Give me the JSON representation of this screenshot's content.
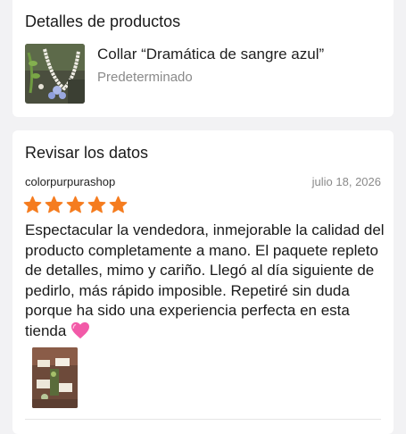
{
  "products_section": {
    "title": "Detalles de productos",
    "item": {
      "name": "Collar “Dramática de sangre azul”",
      "variant": "Predeterminado"
    }
  },
  "review_section": {
    "title": "Revisar los datos",
    "shop_name": "colorpurpurashop",
    "date": "julio 18, 2026",
    "rating": 5,
    "rating_max": 5,
    "text": "Espectacular la vendedora, inmejorable la calidad del producto completamente a mano. El paquete repleto de detalles, mimo y cariño. Llegó al día siguiente de pedirlo, más rápido imposible. Repetiré sin duda porque ha sido una experiencia perfecta en esta tienda",
    "star_color": "#f57c1f"
  }
}
